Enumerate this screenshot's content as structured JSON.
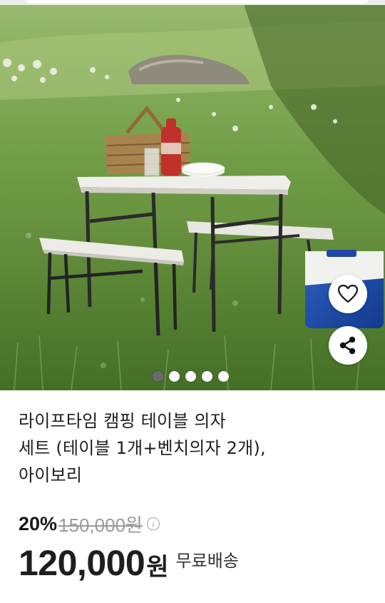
{
  "gallery": {
    "image_alt": "Camping table with two benches on grass",
    "slide_count": 5,
    "active_slide": 1
  },
  "actions": {
    "wishlist_icon": "heart-icon",
    "share_icon": "share-icon"
  },
  "product": {
    "title": "라이프타임 캠핑 테이블 의자\n세트 (테이블 1개+벤치의자 2개),\n아이보리",
    "discount": "20%",
    "original_price": "150,000원",
    "sale_price": "120,000",
    "currency": "원",
    "shipping": "무료배송"
  },
  "colors": {
    "text": "#1e1e1e",
    "muted": "#9a9a9a",
    "grass": "#5f8a3a"
  }
}
